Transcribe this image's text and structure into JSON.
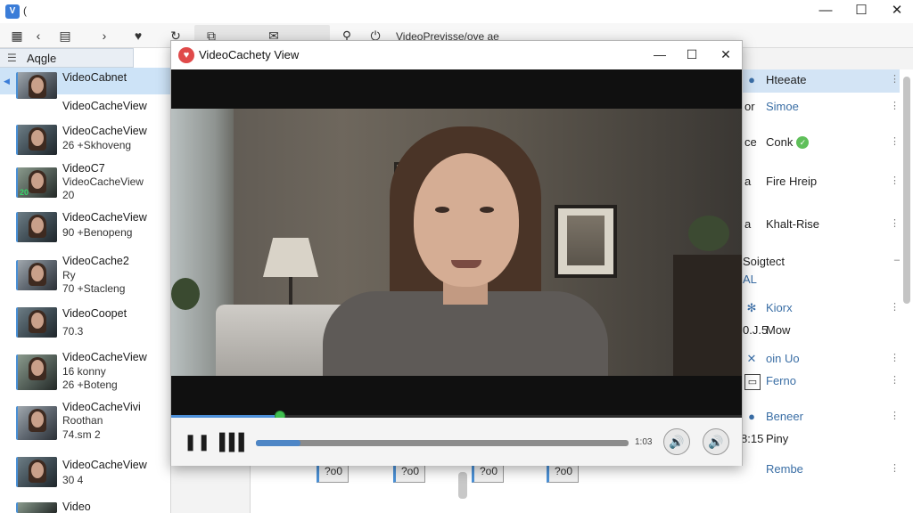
{
  "app": {
    "title": "(",
    "window_controls": {
      "minimize": "—",
      "maximize": "☐",
      "close": "✕"
    }
  },
  "toolbar": {
    "label": "VideoPrevisse/oye ae"
  },
  "left_panel": {
    "column_header": "Aqgle",
    "items": [
      {
        "line1": "VideoCabnet",
        "line2": "",
        "line3": "",
        "time": ""
      },
      {
        "line1": "VideoCacheView",
        "line2": "",
        "line3": "",
        "time": ""
      },
      {
        "line1": "VideoCacheView",
        "line2": "26 +Skhoveng",
        "line3": "",
        "time": ""
      },
      {
        "line1": "VideoC7",
        "line2": "VideoCacheView",
        "line3": "20",
        "time": "20"
      },
      {
        "line1": "VideoCacheView",
        "line2": "90 +Benopeng",
        "line3": "",
        "time": ""
      },
      {
        "line1": "VideoCache2",
        "line2": "Ry",
        "line3": "70 +Stacleng",
        "time": ""
      },
      {
        "line1": "VideoCoopet",
        "line2": "70.3",
        "line3": "",
        "time": ""
      },
      {
        "line1": "VideoCacheView",
        "line2": "16 konny",
        "line3": "26 +Boteng",
        "time": ""
      },
      {
        "line1": "VideoCacheVivi",
        "line2": "Roothan",
        "line3": "74.sm 2",
        "time": ""
      },
      {
        "line1": "VideoCacheView",
        "line2": "30 4",
        "line3": "",
        "time": ""
      },
      {
        "line1": "Video",
        "line2": "",
        "line3": "",
        "time": ""
      }
    ]
  },
  "player": {
    "title": "VideoCachety View",
    "progress": 0.19,
    "seek": 0.12,
    "time_label": "1:03",
    "pause_glyph": "❚❚",
    "stop_glyph": "▌▌▌",
    "volume_glyph": "🔊"
  },
  "right_panel": {
    "items": [
      {
        "icon": "info-icon",
        "label": "Hteeate",
        "selected": true
      },
      {
        "icon": "box-icon",
        "prefix": "or",
        "label": "Simoe",
        "blue": true
      },
      {
        "icon": "box-icon",
        "prefix": "ce",
        "label": "Conk",
        "badge": "✓"
      },
      {
        "icon": "box-icon",
        "prefix": "a",
        "label": "Fire Hreip"
      },
      {
        "icon": "box-icon",
        "prefix": "a",
        "label": "Khalt-Rise"
      },
      {
        "icon": "none",
        "prefix": "",
        "label": "Soigtect",
        "sub": "AL"
      },
      {
        "icon": "gear-icon",
        "label": "Kiorx",
        "blue": true
      },
      {
        "icon": "none",
        "prefix": "0.J.5",
        "label": "Mow"
      },
      {
        "icon": "x-icon",
        "label": "oin Uo",
        "blue": true
      },
      {
        "icon": "box-icon",
        "prefix": "",
        "label": "Ferno",
        "blue": true
      },
      {
        "icon": "info-icon",
        "label": "Beneer",
        "blue": true
      },
      {
        "icon": "none",
        "prefix": "8:15",
        "label": "Piny"
      },
      {
        "icon": "none",
        "prefix": "",
        "label": "Rembe",
        "blue": true
      }
    ]
  },
  "mid_panel": {
    "thumb_labels": [
      "?o0",
      "?o0",
      "?o0",
      "?o0"
    ]
  }
}
